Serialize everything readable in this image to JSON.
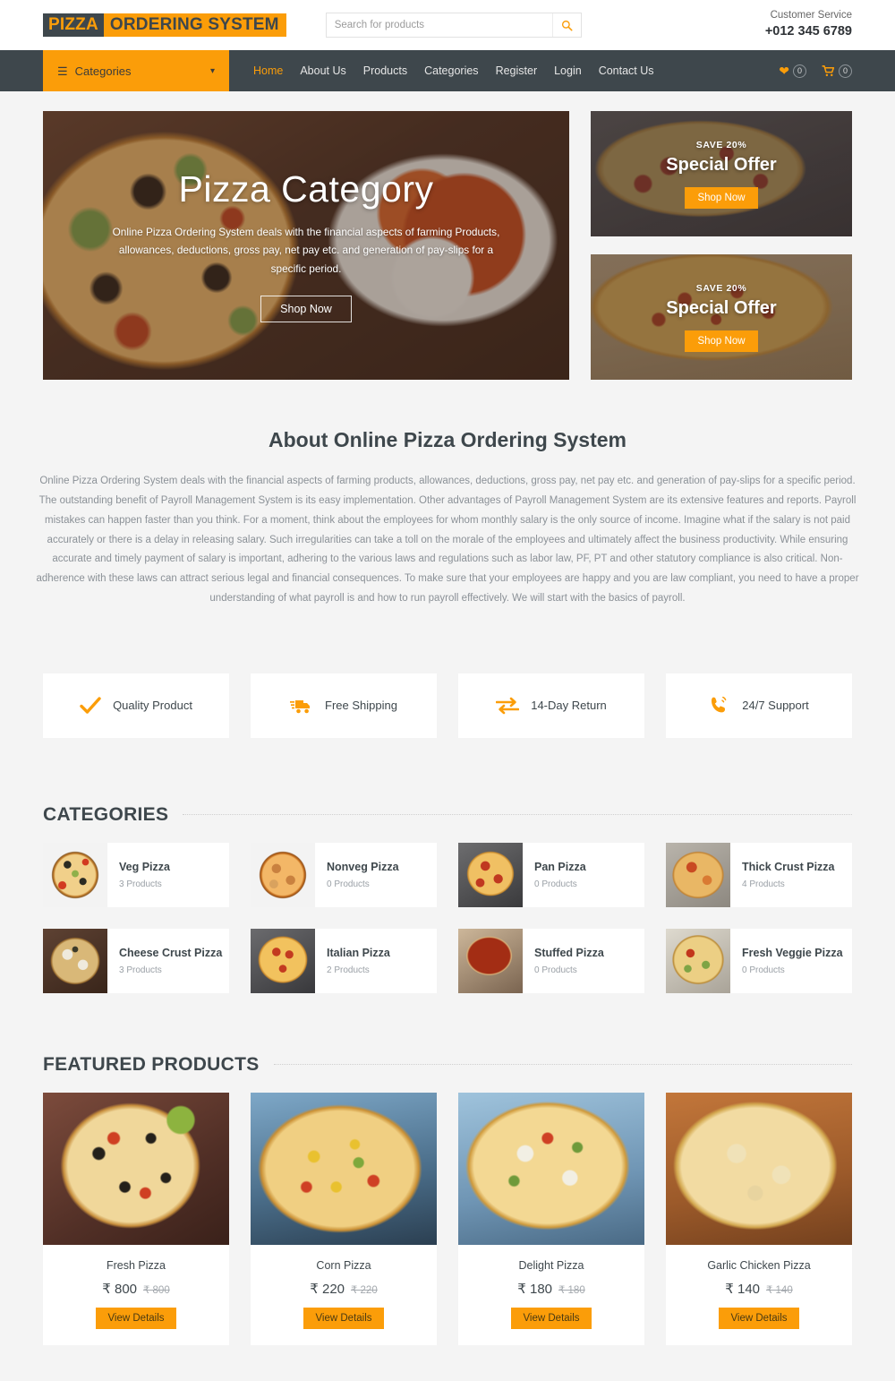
{
  "header": {
    "logo_primary": "PIZZA",
    "logo_secondary": "ORDERING SYSTEM",
    "search_placeholder": "Search for products",
    "search_value": "",
    "search_icon": "search-icon",
    "customer_service_label": "Customer Service",
    "phone": "+012 345 6789"
  },
  "nav": {
    "categories_button": "Categories",
    "links": [
      {
        "label": "Home",
        "active": true
      },
      {
        "label": "About Us",
        "active": false
      },
      {
        "label": "Products",
        "active": false
      },
      {
        "label": "Categories",
        "active": false
      },
      {
        "label": "Register",
        "active": false
      },
      {
        "label": "Login",
        "active": false
      },
      {
        "label": "Contact Us",
        "active": false
      }
    ],
    "wishlist_count": "0",
    "cart_count": "0"
  },
  "hero": {
    "title": "Pizza Category",
    "description": "Online Pizza Ordering System deals with the financial aspects of farming Products, allowances, deductions, gross pay, net pay etc. and generation of pay-slips for a specific period.",
    "button": "Shop Now"
  },
  "promos": [
    {
      "save": "SAVE 20%",
      "title": "Special Offer",
      "button": "Shop Now"
    },
    {
      "save": "SAVE 20%",
      "title": "Special Offer",
      "button": "Shop Now"
    }
  ],
  "about": {
    "title": "About Online Pizza Ordering System",
    "body": "Online Pizza Ordering System deals with the financial aspects of farming products, allowances, deductions, gross pay, net pay etc. and generation of pay-slips for a specific period. The outstanding benefit of Payroll Management System is its easy implementation. Other advantages of Payroll Management System are its extensive features and reports. Payroll mistakes can happen faster than you think. For a moment, think about the employees for whom monthly salary is the only source of income. Imagine what if the salary is not paid accurately or there is a delay in releasing salary. Such irregularities can take a toll on the morale of the employees and ultimately affect the business productivity. While ensuring accurate and timely payment of salary is important, adhering to the various laws and regulations such as labor law, PF, PT and other statutory compliance is also critical. Non-adherence with these laws can attract serious legal and financial consequences. To make sure that your employees are happy and you are law compliant, you need to have a proper understanding of what payroll is and how to run payroll effectively. We will start with the basics of payroll."
  },
  "features": [
    {
      "icon": "check-icon",
      "label": "Quality Product"
    },
    {
      "icon": "truck-icon",
      "label": "Free Shipping"
    },
    {
      "icon": "exchange-icon",
      "label": "14-Day Return"
    },
    {
      "icon": "phone-icon",
      "label": "24/7 Support"
    }
  ],
  "categories_section": {
    "title": "CATEGORIES",
    "items": [
      {
        "name": "Veg Pizza",
        "count": "3 Products"
      },
      {
        "name": "Nonveg Pizza",
        "count": "0 Products"
      },
      {
        "name": "Pan Pizza",
        "count": "0 Products"
      },
      {
        "name": "Thick Crust Pizza",
        "count": "4 Products"
      },
      {
        "name": "Cheese Crust Pizza",
        "count": "3 Products"
      },
      {
        "name": "Italian Pizza",
        "count": "2 Products"
      },
      {
        "name": "Stuffed Pizza",
        "count": "0 Products"
      },
      {
        "name": "Fresh Veggie Pizza",
        "count": "0 Products"
      }
    ]
  },
  "featured_section": {
    "title": "FEATURED PRODUCTS",
    "items": [
      {
        "name": "Fresh Pizza",
        "price": "₹ 800",
        "old_price": "₹ 800",
        "button": "View Details"
      },
      {
        "name": "Corn Pizza",
        "price": "₹ 220",
        "old_price": "₹ 220",
        "button": "View Details"
      },
      {
        "name": "Delight Pizza",
        "price": "₹ 180",
        "old_price": "₹ 180",
        "button": "View Details"
      },
      {
        "name": "Garlic Chicken Pizza",
        "price": "₹ 140",
        "old_price": "₹ 140",
        "button": "View Details"
      }
    ]
  },
  "colors": {
    "accent": "#fb9d09",
    "dark": "#3e474c",
    "page_bg": "#f4f4f4",
    "card_bg": "#ffffff",
    "muted_text": "#9aa0a6"
  }
}
